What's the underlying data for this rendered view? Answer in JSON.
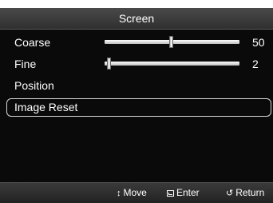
{
  "title": "Screen",
  "items": [
    {
      "label": "Coarse",
      "value": "50",
      "level": 0.5
    },
    {
      "label": "Fine",
      "value": "2",
      "level": 0.02
    },
    {
      "label": "Position"
    },
    {
      "label": "Image Reset",
      "selected": true
    }
  ],
  "footer": {
    "move": {
      "icon": "up-down-arrows-icon",
      "label": "Move"
    },
    "enter": {
      "icon": "enter-icon",
      "label": "Enter"
    },
    "return": {
      "icon": "return-arrow-icon",
      "label": "Return"
    }
  },
  "colors": {
    "panel": "#0a0a0a",
    "bar": "#3a3a3a",
    "text": "#ffffff"
  }
}
